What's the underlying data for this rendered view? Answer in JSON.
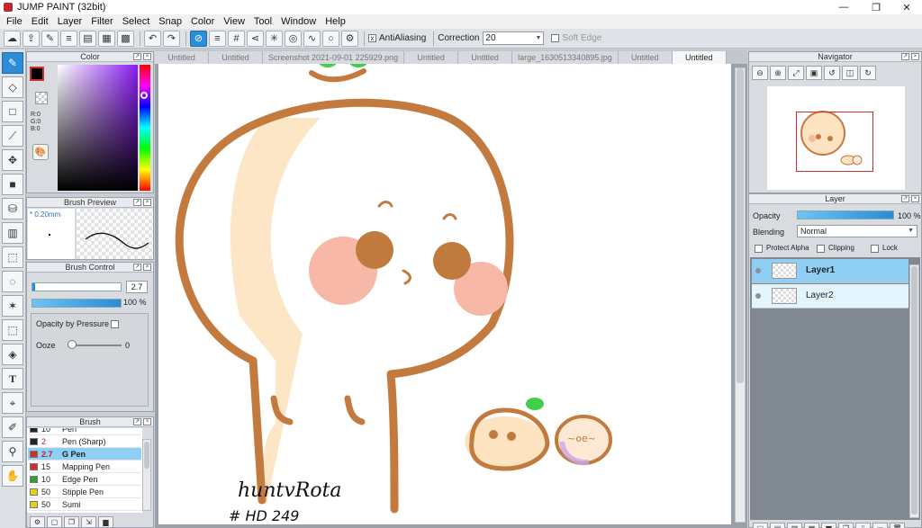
{
  "window": {
    "title": "JUMP PAINT (32bit)",
    "minimize": "—",
    "maximize": "❐",
    "close": "✕"
  },
  "menu": [
    "File",
    "Edit",
    "Layer",
    "Filter",
    "Select",
    "Snap",
    "Color",
    "View",
    "Tool",
    "Window",
    "Help"
  ],
  "toolbar": {
    "antialiasing_label": "AntiAliasing",
    "correction_label": "Correction",
    "correction_value": "20",
    "soft_edge_label": "Soft Edge"
  },
  "color_panel": {
    "title": "Color",
    "r": "R:0",
    "g": "G:0",
    "b": "B:0"
  },
  "brush_preview": {
    "title": "Brush Preview",
    "size": "* 0.20mm"
  },
  "brush_control": {
    "title": "Brush Control",
    "size_value": "2.7",
    "opacity_value": "100 %",
    "opacity_by_pressure": "Opacity by Pressure",
    "ooze_label": "Ooze",
    "ooze_value": "0"
  },
  "brush_list": {
    "title": "Brush",
    "items": [
      {
        "size": "10",
        "name": "Pen",
        "color": "#222222"
      },
      {
        "size": "2",
        "name": "Pen (Sharp)",
        "color": "#222222"
      },
      {
        "size": "2.7",
        "name": "G Pen",
        "color": "#d12e2e"
      },
      {
        "size": "15",
        "name": "Mapping Pen",
        "color": "#d12e2e"
      },
      {
        "size": "10",
        "name": "Edge Pen",
        "color": "#2aa52a"
      },
      {
        "size": "50",
        "name": "Stipple Pen",
        "color": "#e4d020"
      },
      {
        "size": "50",
        "name": "Sumi",
        "color": "#e4d020"
      }
    ]
  },
  "tabs": [
    "Untitled",
    "Untitled",
    "Screenshot 2021-09-01 225929.png",
    "Untitled",
    "Untitled",
    "large_1630513340895.jpg",
    "Untitled",
    "Untitled"
  ],
  "active_tab_index": 7,
  "canvas": {
    "signature": "huntvRota",
    "hashtag": "# HD 249"
  },
  "navigator": {
    "title": "Navigator"
  },
  "layer_panel": {
    "title": "Layer",
    "opacity_label": "Opacity",
    "opacity_value": "100 %",
    "blending_label": "Blending",
    "blending_value": "Normal",
    "protect_alpha": "Protect Alpha",
    "clipping": "Clipping",
    "lock": "Lock",
    "layers": [
      {
        "name": "Layer1",
        "selected": true
      },
      {
        "name": "Layer2",
        "selected": false
      }
    ]
  },
  "colors": {
    "accent": "#2e8bd6",
    "selection": "#8fcff3",
    "outline": "#c27a3f",
    "blush": "#f7b8a8",
    "eye": "#c07a3e",
    "sprout": "#3fcf4a",
    "highlight": "#fde3c0"
  }
}
